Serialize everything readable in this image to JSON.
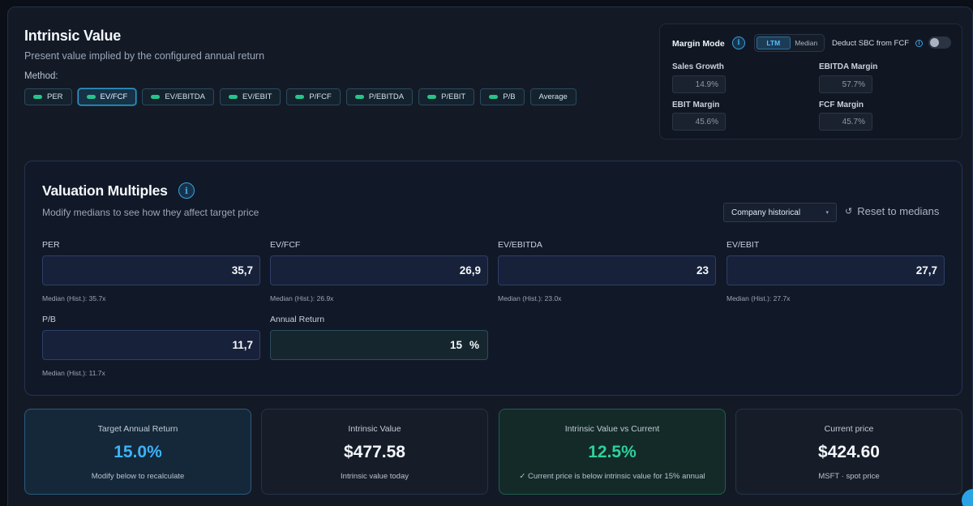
{
  "header": {
    "title": "Intrinsic Value",
    "subtitle": "Present value implied by the configured annual return",
    "method_label": "Method:"
  },
  "methods": [
    {
      "label": "PER",
      "active": false,
      "dot": true
    },
    {
      "label": "EV/FCF",
      "active": true,
      "dot": true
    },
    {
      "label": "EV/EBITDA",
      "active": false,
      "dot": true
    },
    {
      "label": "EV/EBIT",
      "active": false,
      "dot": true
    },
    {
      "label": "P/FCF",
      "active": false,
      "dot": true
    },
    {
      "label": "P/EBITDA",
      "active": false,
      "dot": true
    },
    {
      "label": "P/EBIT",
      "active": false,
      "dot": true
    },
    {
      "label": "P/B",
      "active": false,
      "dot": true
    },
    {
      "label": "Average",
      "active": false,
      "dot": false
    }
  ],
  "margin_mode": {
    "title": "Margin Mode",
    "info_icon": "i",
    "options": [
      "LTM",
      "Median"
    ],
    "selected": "LTM",
    "sbc_label": "Deduct SBC from FCF",
    "sbc_info_icon": "i",
    "sbc_enabled": false,
    "fields": {
      "sales_growth": {
        "label": "Sales Growth",
        "value": "14.9%"
      },
      "ebitda_margin": {
        "label": "EBITDA Margin",
        "value": "57.7%"
      },
      "ebit_margin": {
        "label": "EBIT Margin",
        "value": "45.6%"
      },
      "fcf_margin": {
        "label": "FCF Margin",
        "value": "45.7%"
      }
    }
  },
  "valuation": {
    "title": "Valuation Multiples",
    "info_icon": "i",
    "subtitle": "Modify medians to see how they affect target price",
    "source_select": "Company historical",
    "source_caret": "▾",
    "reset_icon": "↺",
    "reset_label": "Reset to medians",
    "multiples": {
      "per": {
        "label": "PER",
        "value": "35,7",
        "hint": "Median (Hist.): 35.7x"
      },
      "ev_fcf": {
        "label": "EV/FCF",
        "value": "26,9",
        "hint": "Median (Hist.): 26.9x"
      },
      "ev_ebitda": {
        "label": "EV/EBITDA",
        "value": "23",
        "hint": "Median (Hist.): 23.0x"
      },
      "ev_ebit": {
        "label": "EV/EBIT",
        "value": "27,7",
        "hint": "Median (Hist.): 27.7x"
      },
      "pb": {
        "label": "P/B",
        "value": "11,7",
        "hint": "Median (Hist.): 11.7x"
      }
    },
    "annual_return": {
      "label": "Annual Return",
      "value": "15",
      "unit": "%"
    }
  },
  "kpis": {
    "target_return": {
      "label": "Target Annual Return",
      "value": "15.0%",
      "desc": "Modify below to recalculate"
    },
    "intrinsic_value": {
      "label": "Intrinsic Value",
      "value": "$477.58",
      "desc": "Intrinsic value today"
    },
    "iv_vs_current": {
      "label": "Intrinsic Value vs Current",
      "value": "12.5%",
      "desc": "✓ Current price is below intrinsic value for 15% annual"
    },
    "current_price": {
      "label": "Current price",
      "value": "$424.60",
      "desc": "MSFT · spot price"
    }
  },
  "colors": {
    "accent_blue": "#3db3f5",
    "accent_green": "#2ed19a",
    "method_dot": "#27c48a"
  }
}
